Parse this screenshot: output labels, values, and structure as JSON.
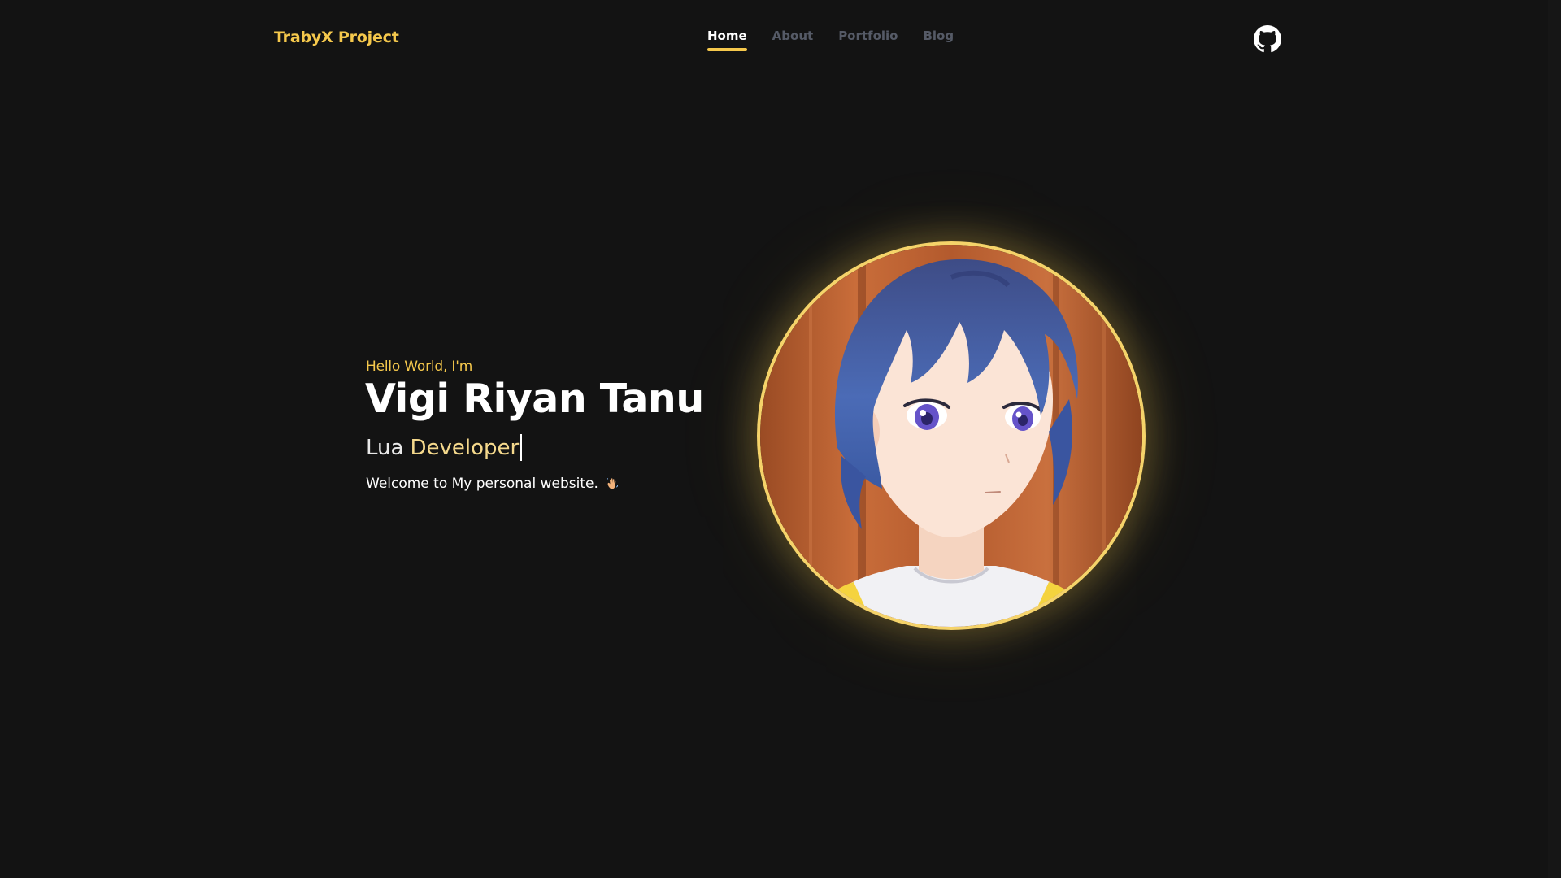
{
  "header": {
    "brand": "TrabyX Project",
    "nav": [
      {
        "label": "Home",
        "active": true
      },
      {
        "label": "About",
        "active": false
      },
      {
        "label": "Portfolio",
        "active": false
      },
      {
        "label": "Blog",
        "active": false
      }
    ],
    "github_icon": "github-icon"
  },
  "hero": {
    "greeting": "Hello World, I'm",
    "name": "Vigi Riyan Tanu",
    "role_prefix": "Lua",
    "role_highlight": "Developer",
    "welcome": "Welcome to My personal website.",
    "welcome_icon": "waving-hand-icon"
  },
  "avatar": {
    "icon": "avatar-anime-portrait"
  },
  "colors": {
    "background": "#131313",
    "accent": "#f5c84c",
    "nav_inactive": "#555a66",
    "role_highlight": "#f5d98c"
  }
}
